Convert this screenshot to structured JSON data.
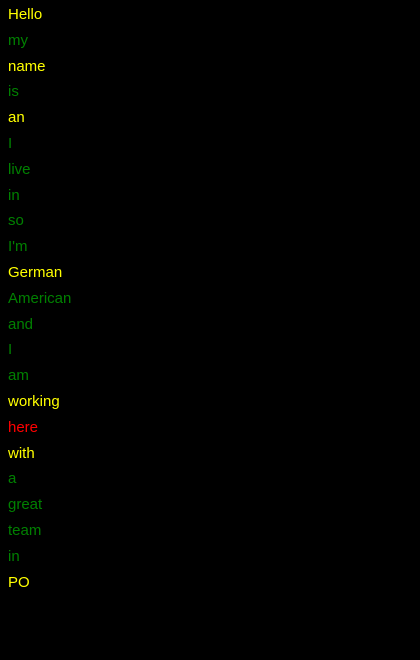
{
  "words": [
    {
      "text": "Hello",
      "color": "yellow"
    },
    {
      "text": "my",
      "color": "green"
    },
    {
      "text": "name",
      "color": "yellow"
    },
    {
      "text": "is",
      "color": "green"
    },
    {
      "text": "an",
      "color": "yellow"
    },
    {
      "text": "I",
      "color": "green"
    },
    {
      "text": "live",
      "color": "green"
    },
    {
      "text": "in",
      "color": "green"
    },
    {
      "text": "so",
      "color": "green"
    },
    {
      "text": "I'm",
      "color": "green"
    },
    {
      "text": "German",
      "color": "yellow"
    },
    {
      "text": "American",
      "color": "green"
    },
    {
      "text": "and",
      "color": "green"
    },
    {
      "text": "I",
      "color": "green"
    },
    {
      "text": "am",
      "color": "green"
    },
    {
      "text": "working",
      "color": "yellow"
    },
    {
      "text": "here",
      "color": "red"
    },
    {
      "text": "with",
      "color": "yellow"
    },
    {
      "text": "a",
      "color": "green"
    },
    {
      "text": "great",
      "color": "green"
    },
    {
      "text": "team",
      "color": "green"
    },
    {
      "text": "in",
      "color": "green"
    },
    {
      "text": "PO",
      "color": "yellow"
    }
  ],
  "colors": {
    "yellow": "#ffff00",
    "green": "#008000",
    "red": "#ff0000",
    "background": "#000000"
  }
}
